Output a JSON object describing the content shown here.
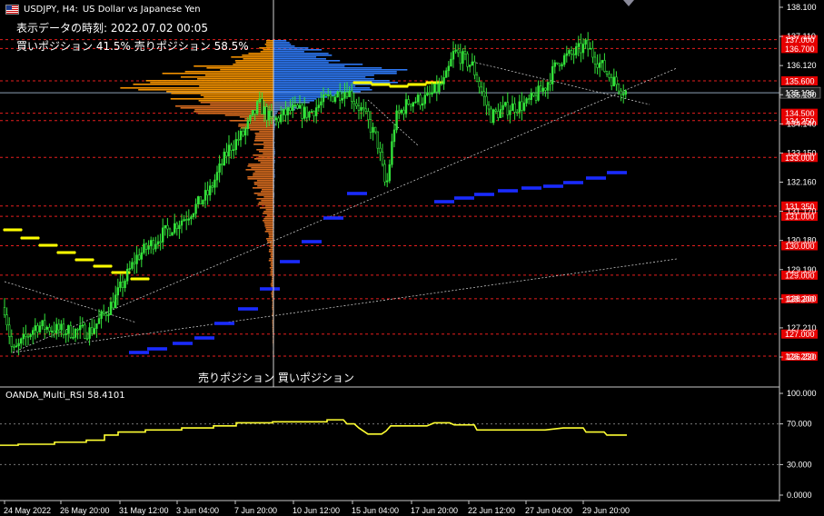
{
  "header": {
    "symbol": "USDJPY, H4:",
    "description": "US Dollar vs Japanese Yen",
    "display_time": "表示データの時刻: 2022.07.02 00:05",
    "position_ratio": "買いポジション 41.5% 売りポジション 58.5%",
    "profile_label": "売りポジション 買いポジション"
  },
  "indicator": {
    "label": "OANDA_Multi_RSI 58.4101",
    "scale_labels": [
      "100.000",
      "70.000",
      "30.000",
      "0.0000"
    ]
  },
  "price_axis": {
    "ticks": [
      "138.100",
      "137.110",
      "136.120",
      "135.130",
      "134.140",
      "133.150",
      "132.160",
      "131.170",
      "130.180",
      "129.190",
      "128.200",
      "127.210",
      "126.220"
    ],
    "current_price": "135.196",
    "order_levels": [
      "137.000",
      "136.700",
      "135.600",
      "134.500",
      "134.250",
      "133.000",
      "131.350",
      "131.000",
      "130.000",
      "129.000",
      "128.200",
      "127.000",
      "126.250"
    ]
  },
  "time_axis": {
    "labels": [
      "24 May 2022",
      "26 May 20:00",
      "31 May 12:00",
      "3 Jun 04:00",
      "7 Jun 20:00",
      "10 Jun 12:00",
      "15 Jun 04:00",
      "17 Jun 20:00",
      "22 Jun 12:00",
      "27 Jun 04:00",
      "29 Jun 20:00"
    ]
  },
  "colors": {
    "background": "#000000",
    "bull_candle": "#33e33a",
    "bear_candle": "#33e33a",
    "order_line": "#e61e1e",
    "order_label_bg": "#e60000",
    "sell_profile": "#ff9900",
    "buy_profile": "#2f7dff",
    "yellow_markers": "#ffff00",
    "blue_markers": "#1a2bff",
    "rsi_line": "#ffff33",
    "current_price_bg": "#1e1e1e"
  },
  "icons": {
    "flag": "us-flag-icon",
    "dropdown": "triangle-down-icon"
  }
}
